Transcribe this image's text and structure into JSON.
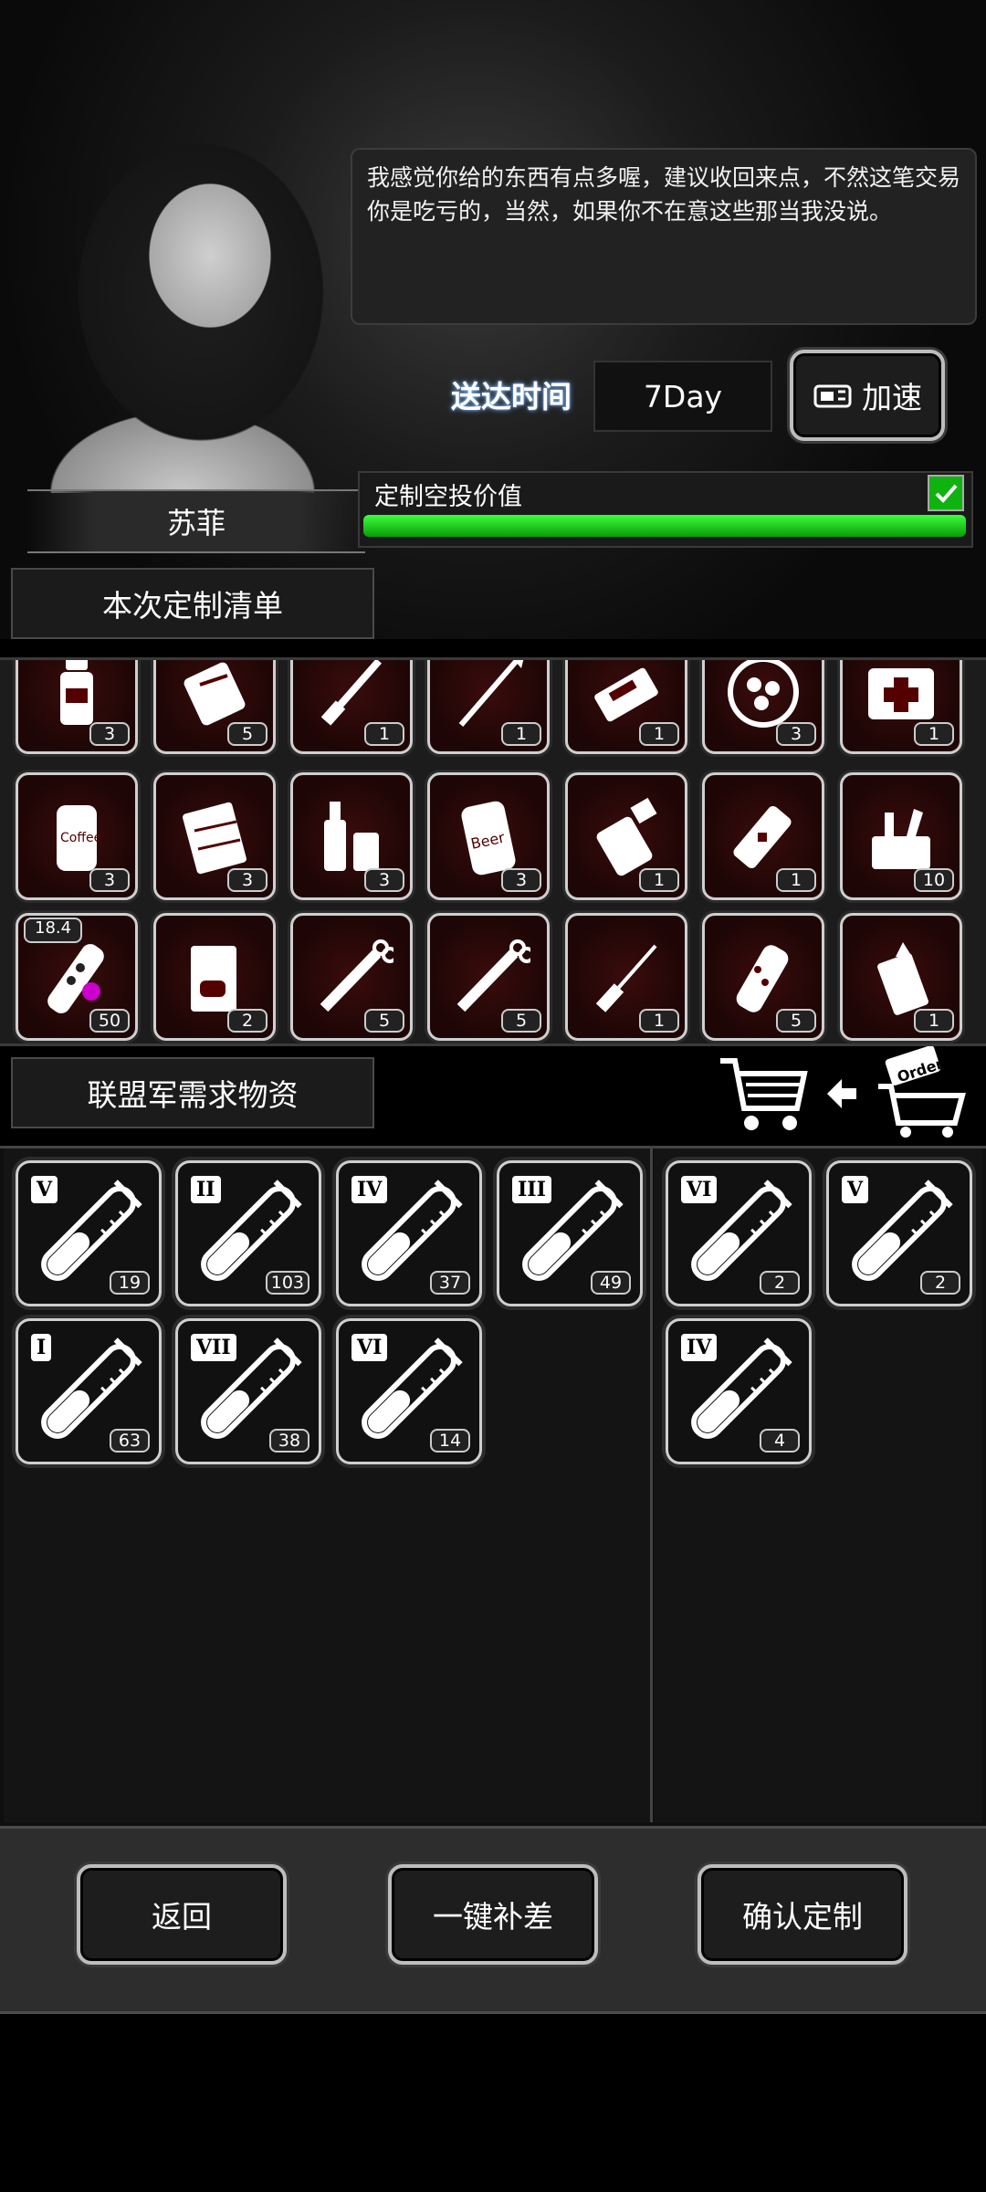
{
  "npc": {
    "name": "苏菲",
    "dialog": "我感觉你给的东西有点多喔，建议收回来点，不然这笔交易你是吃亏的，当然，如果你不在意这些那当我没说。"
  },
  "delivery": {
    "label": "送达时间",
    "value": "7Day",
    "speed_label": "加速"
  },
  "airdrop_value": {
    "label": "定制空投价值",
    "checked": true,
    "fill_fraction": 1.0
  },
  "custom_list": {
    "title": "本次定制清单",
    "items": [
      {
        "icon": "bottle-icon",
        "count": "3"
      },
      {
        "icon": "scroll-icon",
        "count": "5"
      },
      {
        "icon": "knife-icon",
        "count": "1"
      },
      {
        "icon": "spear-icon",
        "count": "1"
      },
      {
        "icon": "ammo-box-icon",
        "count": "1"
      },
      {
        "icon": "food-plate-icon",
        "count": "3"
      },
      {
        "icon": "medkit-icon",
        "count": "1"
      },
      {
        "icon": "coffee-can-icon",
        "count": "3"
      },
      {
        "icon": "chocolate-icon",
        "count": "3"
      },
      {
        "icon": "liquor-icon",
        "count": "3"
      },
      {
        "icon": "beer-can-icon",
        "count": "3"
      },
      {
        "icon": "spray-bottle-icon",
        "count": "1"
      },
      {
        "icon": "battery-icon",
        "count": "1"
      },
      {
        "icon": "toolkit-icon",
        "count": "10"
      },
      {
        "icon": "candy-tube-icon",
        "count": "50",
        "badge": "18.4"
      },
      {
        "icon": "book-icon",
        "count": "2"
      },
      {
        "icon": "syringe-icon",
        "count": "5"
      },
      {
        "icon": "syringe-icon",
        "count": "5"
      },
      {
        "icon": "screwdriver-icon",
        "count": "1"
      },
      {
        "icon": "flashlight-icon",
        "count": "5"
      },
      {
        "icon": "lighter-icon",
        "count": "1"
      }
    ]
  },
  "alliance_needs": {
    "title": "联盟军需求物资",
    "cart_icon": "shopping-cart-icon",
    "order_icon": "order-cart-icon",
    "left": [
      {
        "grade": "V",
        "count": "19"
      },
      {
        "grade": "II",
        "count": "103"
      },
      {
        "grade": "IV",
        "count": "37"
      },
      {
        "grade": "III",
        "count": "49"
      },
      {
        "grade": "I",
        "count": "63"
      },
      {
        "grade": "VII",
        "count": "38"
      },
      {
        "grade": "VI",
        "count": "14"
      }
    ],
    "right": [
      {
        "grade": "VI",
        "count": "2"
      },
      {
        "grade": "V",
        "count": "2"
      },
      {
        "grade": "IV",
        "count": "4"
      }
    ]
  },
  "buttons": {
    "back": "返回",
    "fill_gap": "一键补差",
    "confirm": "确认定制"
  }
}
